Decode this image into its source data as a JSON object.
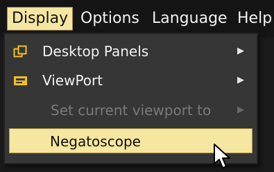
{
  "menubar": {
    "items": [
      {
        "label": "Display"
      },
      {
        "label": "Options"
      },
      {
        "label": "Language"
      },
      {
        "label": "Help"
      }
    ]
  },
  "dropdown": {
    "items": [
      {
        "label": "Desktop Panels",
        "icon": "desktop-panels-icon",
        "submenu": true,
        "enabled": true
      },
      {
        "label": "ViewPort",
        "icon": "viewport-icon",
        "submenu": true,
        "enabled": true
      },
      {
        "label": "Set current viewport to",
        "submenu": true,
        "enabled": false
      },
      {
        "label": "Negatoscope",
        "highlighted": true,
        "enabled": true
      }
    ]
  },
  "colors": {
    "highlight": "#f5e6a0",
    "icon_accent": "#f0c020",
    "menu_bg": "#363636",
    "menubar_bg": "#151515"
  }
}
